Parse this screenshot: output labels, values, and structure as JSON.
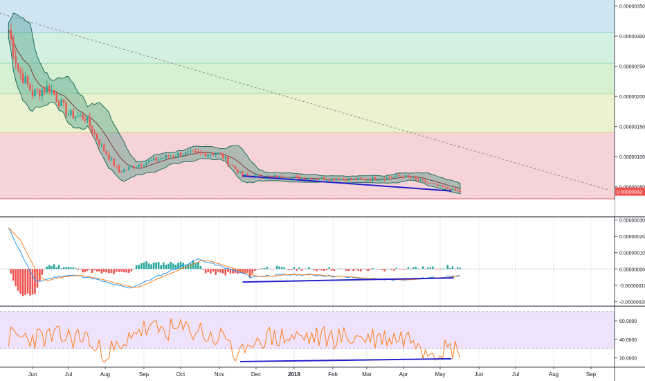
{
  "chart_data": [
    {
      "type": "candlestick",
      "title": "",
      "x_ticks": [
        "Jun",
        "Jul",
        "Aug",
        "Sep",
        "Oct",
        "Nov",
        "Dec",
        "2019",
        "Feb",
        "Mar",
        "Apr",
        "May",
        "Jun",
        "Jul",
        "Aug",
        "Sep"
      ],
      "y_ticks": [
        "0.00000350",
        "0.00000300",
        "0.00000250",
        "0.00000200",
        "0.00000150",
        "0.00000100",
        "0.00000050"
      ],
      "ylim": [
        3e-07,
        3.6e-06
      ],
      "last_price_label": "0.00000042",
      "last_price": 4.2e-07,
      "price_path": [
        {
          "date": "2018-05-12",
          "value": 3.1e-06
        },
        {
          "date": "2018-05-20",
          "value": 2.45e-06
        },
        {
          "date": "2018-06-01",
          "value": 2.05e-06
        },
        {
          "date": "2018-06-15",
          "value": 2.15e-06
        },
        {
          "date": "2018-07-01",
          "value": 1.7e-06
        },
        {
          "date": "2018-07-15",
          "value": 1.65e-06
        },
        {
          "date": "2018-07-28",
          "value": 1.2e-06
        },
        {
          "date": "2018-08-12",
          "value": 7.5e-07
        },
        {
          "date": "2018-09-01",
          "value": 9e-07
        },
        {
          "date": "2018-10-01",
          "value": 1.05e-06
        },
        {
          "date": "2018-11-01",
          "value": 1.05e-06
        },
        {
          "date": "2018-11-20",
          "value": 6.8e-07
        },
        {
          "date": "2019-01-01",
          "value": 6.5e-07
        },
        {
          "date": "2019-03-01",
          "value": 6.2e-07
        },
        {
          "date": "2019-04-01",
          "value": 6.8e-07
        },
        {
          "date": "2019-05-01",
          "value": 5e-07
        },
        {
          "date": "2019-05-17",
          "value": 4.2e-07
        }
      ],
      "fib_zones": [
        {
          "from": 3.06e-06,
          "to": 3.6e-06,
          "color": "#cfe6f2"
        },
        {
          "from": 2.55e-06,
          "to": 3.06e-06,
          "color": "#d4f0e0"
        },
        {
          "from": 2.04e-06,
          "to": 2.55e-06,
          "color": "#d6f0d2"
        },
        {
          "from": 1.4e-06,
          "to": 2.04e-06,
          "color": "#eaf2cf"
        },
        {
          "from": 3e-07,
          "to": 1.4e-06,
          "color": "#f6d3d6"
        }
      ],
      "trendline": {
        "from": {
          "date": "2018-05-01",
          "value": 3.4e-06
        },
        "to": {
          "date": "2019-09-15",
          "value": 4.5e-07
        }
      },
      "support_line": {
        "from": {
          "date": "2018-11-20",
          "value": 6.8e-07
        },
        "to": {
          "date": "2019-05-10",
          "value": 4.3e-07
        }
      }
    },
    {
      "type": "macd",
      "y_ticks": [
        "0.00000030",
        "0.00000020",
        "0.00000010",
        "0.00000000",
        "-0.00000010",
        "-0.00000020"
      ],
      "ylim": [
        -2.2e-07,
        3.2e-07
      ],
      "colors": {
        "macd": "#2196f3",
        "signal": "#ff7f1e",
        "hist_pos": "#26a69a",
        "hist_neg": "#ef5350"
      }
    },
    {
      "type": "rsi",
      "y_ticks": [
        "60.0000",
        "40.0000",
        "20.0000"
      ],
      "ylim": [
        10,
        75
      ],
      "bands": {
        "upper": 70,
        "lower": 30
      },
      "color": "#ff7f1e"
    }
  ]
}
